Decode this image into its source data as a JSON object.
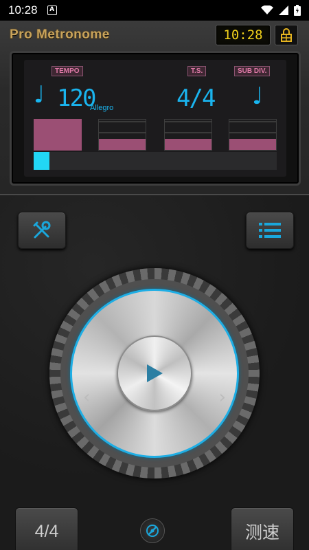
{
  "status": {
    "time": "10:28",
    "notification_letter": "A"
  },
  "header": {
    "title": "Pro Metronome",
    "clock": "10:28"
  },
  "display": {
    "tempo_tag": "TEMPO",
    "ts_tag": "T.S.",
    "subdiv_tag": "SUB DIV.",
    "bpm": "120",
    "tempo_name": "Allegro",
    "time_signature": "4/4",
    "note_symbol": "♩",
    "beats": [
      {
        "index": 1,
        "accent": true,
        "active": true
      },
      {
        "index": 2,
        "accent": false,
        "active": false
      },
      {
        "index": 3,
        "accent": false,
        "active": false
      },
      {
        "index": 4,
        "accent": false,
        "active": false
      }
    ],
    "progress_fraction": 0.065
  },
  "controls": {
    "settings_icon": "tools-icon",
    "list_icon": "list-icon",
    "play_icon": "play-icon",
    "prev_chevron": "‹",
    "next_chevron": "›",
    "time_sig_button": "4/4",
    "tap_button": "测速",
    "tuner_icon": "tuner-icon"
  },
  "colors": {
    "accent_blue": "#1ab4ee",
    "beat_pink": "#9b4f74",
    "clock_yellow": "#f2d21b",
    "title_gold": "#c9a35a"
  }
}
